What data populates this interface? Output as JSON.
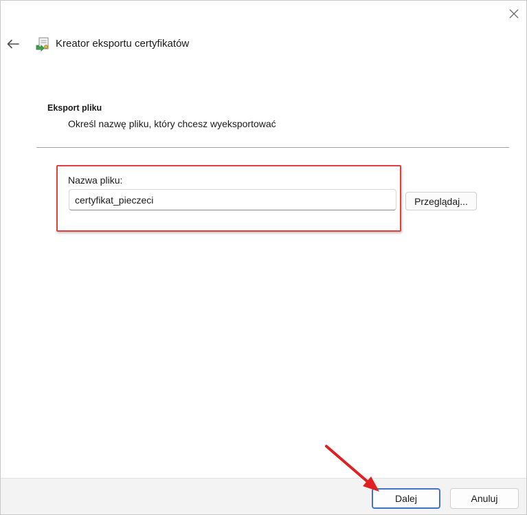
{
  "window": {
    "title": "Kreator eksportu certyfikatów",
    "close_icon": "close-icon",
    "back_icon": "back-arrow-icon",
    "wizard_icon": "certificate-wizard-icon"
  },
  "page": {
    "heading": "Eksport pliku",
    "description": "Określ nazwę pliku, który chcesz wyeksportować"
  },
  "filename": {
    "label": "Nazwa pliku:",
    "value": "certyfikat_pieczeci",
    "browse_label": "Przeglądaj..."
  },
  "footer": {
    "next_label": "Dalej",
    "cancel_label": "Anuluj"
  },
  "annotations": {
    "highlight_color": "#e0403f",
    "arrow_color": "#e02020"
  }
}
